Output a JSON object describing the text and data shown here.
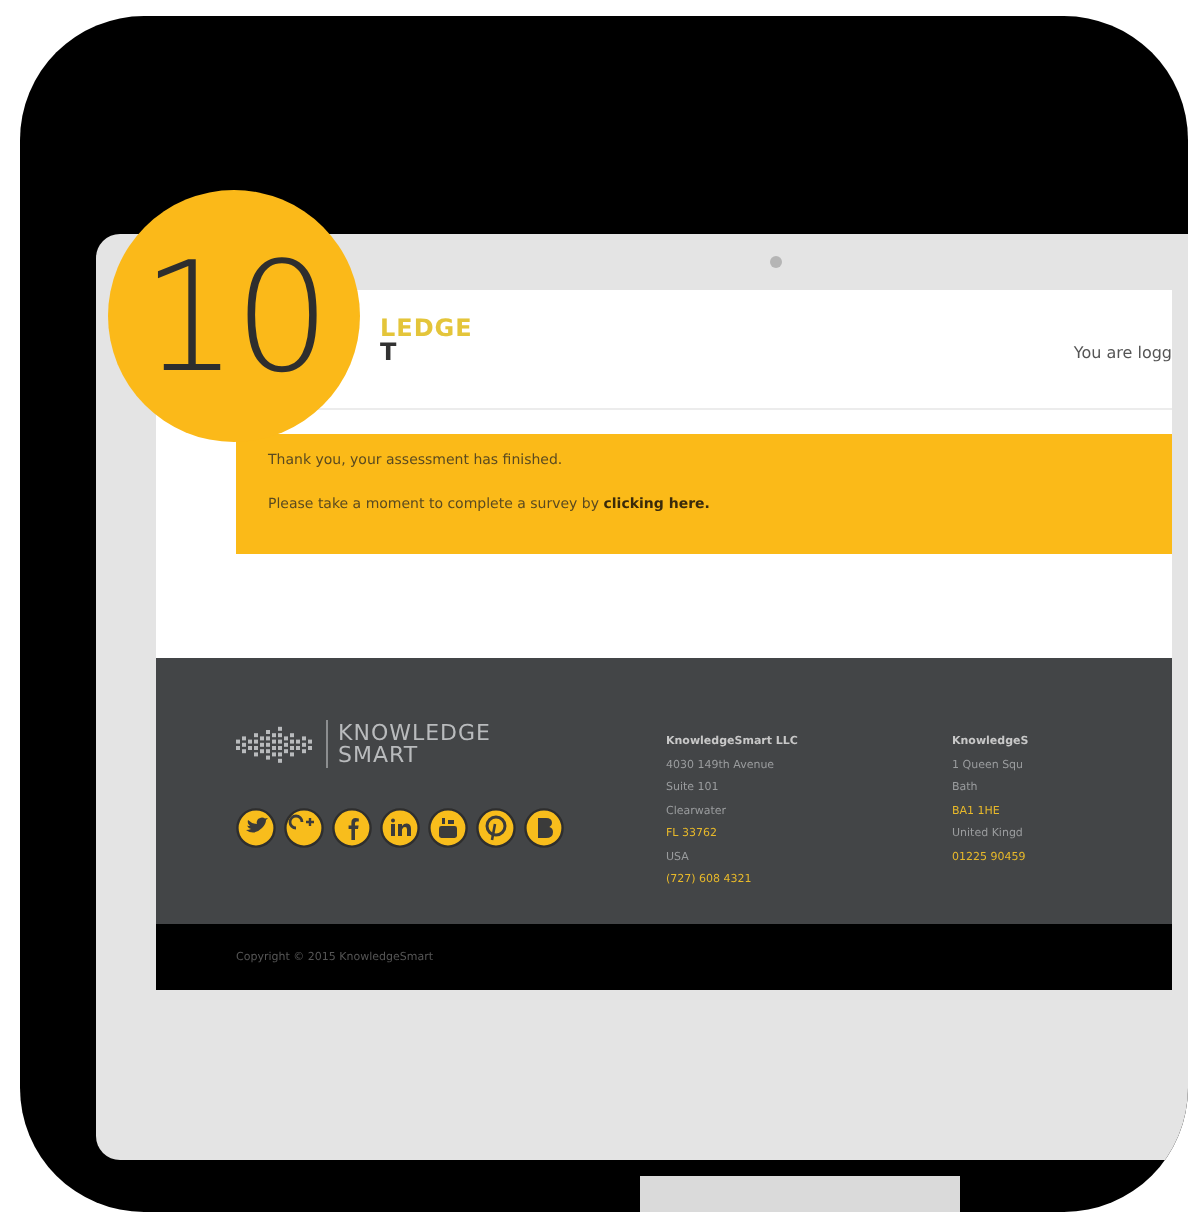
{
  "badge": {
    "number": "10"
  },
  "header": {
    "logo_lines": [
      "LEDGE",
      "T"
    ],
    "user_status": "You are logg"
  },
  "notice": {
    "lines": [
      "Thank you, your assessment has finished.",
      "Please take a moment to complete a survey by **clicking here.**"
    ]
  },
  "footer": {
    "logo_lines": [
      "KNOWLEDGE",
      "SMART"
    ],
    "social_links": [
      {
        "kind": "twitter"
      },
      {
        "kind": "googleplus"
      },
      {
        "kind": "facebook"
      },
      {
        "kind": "linkedin"
      },
      {
        "kind": "youtube"
      },
      {
        "kind": "pinterest"
      },
      {
        "kind": "blog"
      }
    ],
    "addresses": [
      {
        "lines": [
          {
            "text": "KnowledgeSmart LLC",
            "kind": "title"
          },
          {
            "text": "4030 149th Avenue",
            "kind": "plain"
          },
          {
            "text": "Suite 101",
            "kind": "plain"
          },
          {
            "text": "Clearwater",
            "kind": "plain"
          },
          {
            "text": "FL 33762",
            "kind": "accent"
          },
          {
            "text": "USA",
            "kind": "plain"
          },
          {
            "text": "(727) 608 4321",
            "kind": "accent"
          }
        ]
      },
      {
        "lines": [
          {
            "text": "KnowledgeS",
            "kind": "title"
          },
          {
            "text": "1 Queen Squ",
            "kind": "plain"
          },
          {
            "text": "Bath",
            "kind": "plain"
          },
          {
            "text": "BA1 1HE",
            "kind": "accent"
          },
          {
            "text": "United Kingd",
            "kind": "plain"
          },
          {
            "text": "01225 90459",
            "kind": "accent"
          }
        ]
      }
    ],
    "copyright": "Copyright © 2015 KnowledgeSmart"
  }
}
